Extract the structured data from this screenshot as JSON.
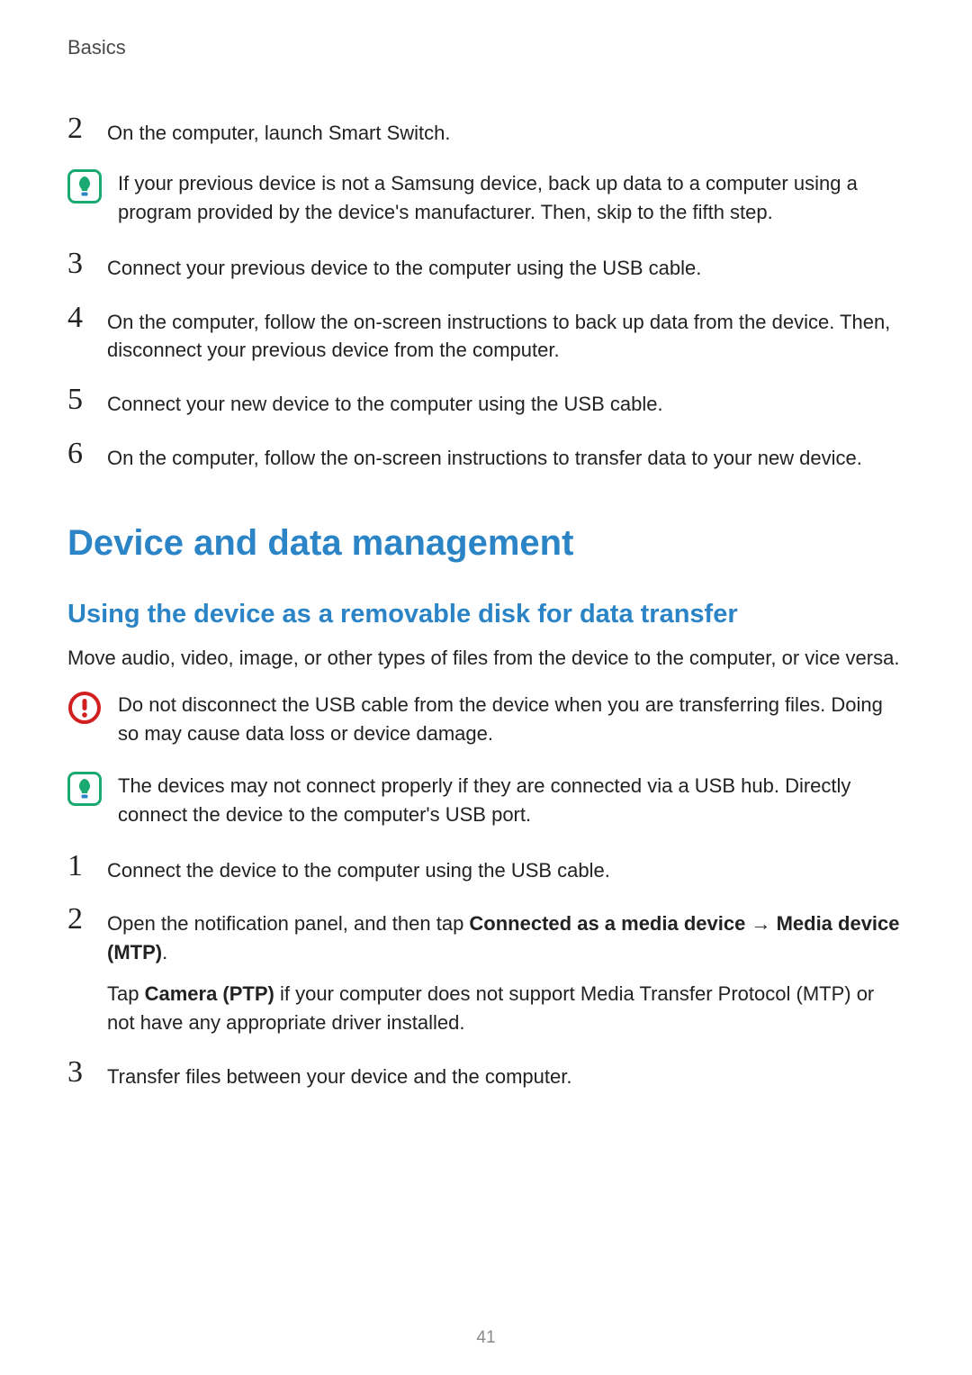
{
  "sectionLabel": "Basics",
  "topSteps": [
    {
      "num": "2",
      "text": "On the computer, launch Smart Switch."
    }
  ],
  "tipNote1": "If your previous device is not a Samsung device, back up data to a computer using a program provided by the device's manufacturer. Then, skip to the fifth step.",
  "topSteps2": [
    {
      "num": "3",
      "text": "Connect your previous device to the computer using the USB cable."
    },
    {
      "num": "4",
      "text": "On the computer, follow the on-screen instructions to back up data from the device. Then, disconnect your previous device from the computer."
    },
    {
      "num": "5",
      "text": "Connect your new device to the computer using the USB cable."
    },
    {
      "num": "6",
      "text": "On the computer, follow the on-screen instructions to transfer data to your new device."
    }
  ],
  "h1": "Device and data management",
  "h2": "Using the device as a removable disk for data transfer",
  "intro": "Move audio, video, image, or other types of files from the device to the computer, or vice versa.",
  "warnNote": "Do not disconnect the USB cable from the device when you are transferring files. Doing so may cause data loss or device damage.",
  "tipNote2": "The devices may not connect properly if they are connected via a USB hub. Directly connect the device to the computer's USB port.",
  "lowerSteps": {
    "s1": {
      "num": "1",
      "text": "Connect the device to the computer using the USB cable."
    },
    "s2": {
      "num": "2",
      "pre": "Open the notification panel, and then tap ",
      "bold1": "Connected as a media device",
      "arrow": " → ",
      "bold2": "Media device (MTP)",
      "post": ".",
      "para2pre": "Tap ",
      "para2bold": "Camera (PTP)",
      "para2post": " if your computer does not support Media Transfer Protocol (MTP) or not have any appropriate driver installed."
    },
    "s3": {
      "num": "3",
      "text": "Transfer files between your device and the computer."
    }
  },
  "pageNumber": "41"
}
